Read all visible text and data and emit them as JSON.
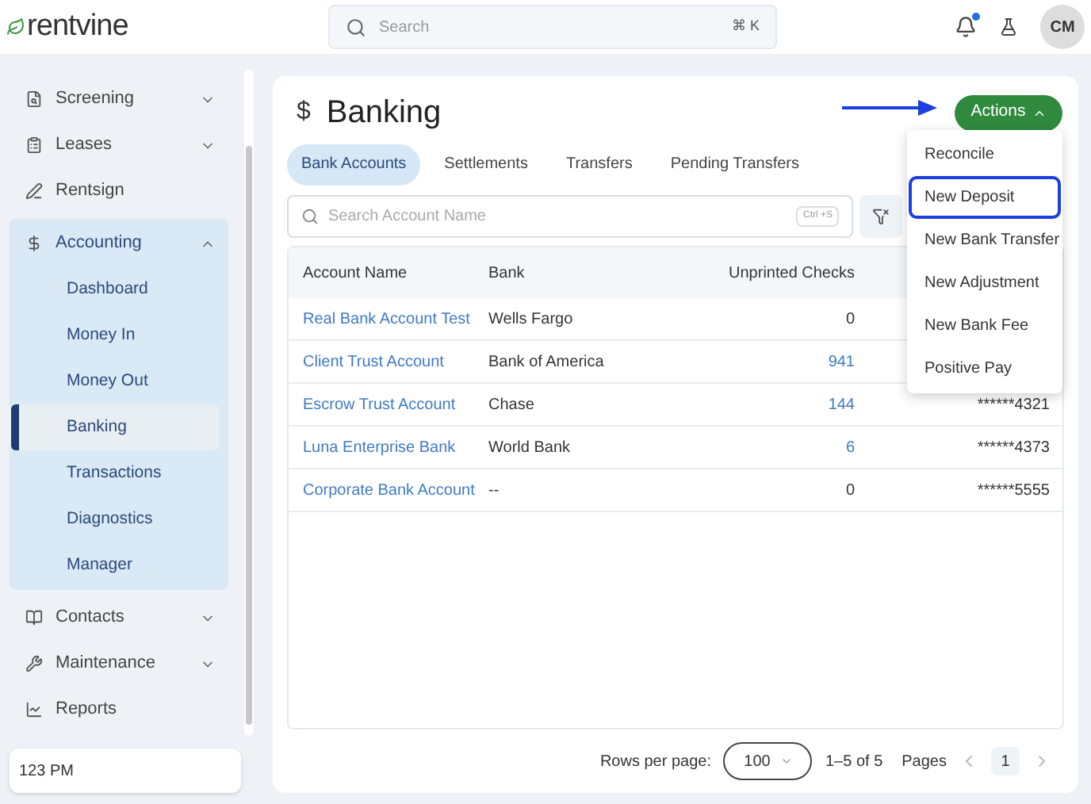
{
  "header": {
    "logo": "rentvine",
    "search": {
      "placeholder": "Search",
      "shortcut": "⌘ K"
    },
    "notification_dot": true,
    "avatar": "CM"
  },
  "sidebar": {
    "items": [
      {
        "label": "Screening",
        "expanded": false
      },
      {
        "label": "Leases",
        "expanded": false
      },
      {
        "label": "Rentsign"
      },
      {
        "label": "Accounting",
        "expanded": true,
        "children": [
          {
            "label": "Dashboard",
            "selected": false
          },
          {
            "label": "Money In",
            "selected": false
          },
          {
            "label": "Money Out",
            "selected": false
          },
          {
            "label": "Banking",
            "selected": true
          },
          {
            "label": "Transactions",
            "selected": false
          },
          {
            "label": "Diagnostics",
            "selected": false
          },
          {
            "label": "Manager",
            "selected": false
          }
        ]
      },
      {
        "label": "Contacts",
        "expanded": false
      },
      {
        "label": "Maintenance",
        "expanded": false
      },
      {
        "label": "Reports"
      }
    ],
    "footer": "123 PM"
  },
  "page": {
    "icon": "$",
    "title": "Banking",
    "actions_button": "Actions",
    "tabs": [
      {
        "label": "Bank Accounts",
        "selected": true
      },
      {
        "label": "Settlements",
        "selected": false
      },
      {
        "label": "Transfers",
        "selected": false
      },
      {
        "label": "Pending Transfers",
        "selected": false
      }
    ],
    "search": {
      "placeholder": "Search Account Name",
      "shortcut": "Ctrl +S"
    },
    "table": {
      "columns": [
        "Account Name",
        "Bank",
        "Unprinted Checks"
      ],
      "rows": [
        {
          "account_name": "Real Bank Account Test",
          "bank": "Wells Fargo",
          "unprinted_checks": "0"
        },
        {
          "account_name": "Client Trust Account",
          "bank": "Bank of America",
          "unprinted_checks": "941"
        },
        {
          "account_name": "Escrow Trust Account",
          "bank": "Chase",
          "unprinted_checks": "144",
          "account_number": "******4321"
        },
        {
          "account_name": "Luna Enterprise Bank",
          "bank": "World Bank",
          "unprinted_checks": "6",
          "account_number": "******4373"
        },
        {
          "account_name": "Corporate Bank Account",
          "bank": "--",
          "unprinted_checks": "0",
          "account_number": "******5555"
        }
      ]
    },
    "pagination": {
      "rows_per_page_label": "Rows per page:",
      "rows_per_page": "100",
      "range": "1–5 of 5",
      "pages_label": "Pages",
      "current_page": "1"
    },
    "actions_menu": [
      {
        "label": "Reconcile",
        "selected": false
      },
      {
        "label": "New Deposit",
        "selected": true
      },
      {
        "label": "New Bank Transfer",
        "selected": false
      },
      {
        "label": "New Adjustment",
        "selected": false
      },
      {
        "label": "New Bank Fee",
        "selected": false
      },
      {
        "label": "Positive Pay",
        "selected": false
      }
    ]
  }
}
